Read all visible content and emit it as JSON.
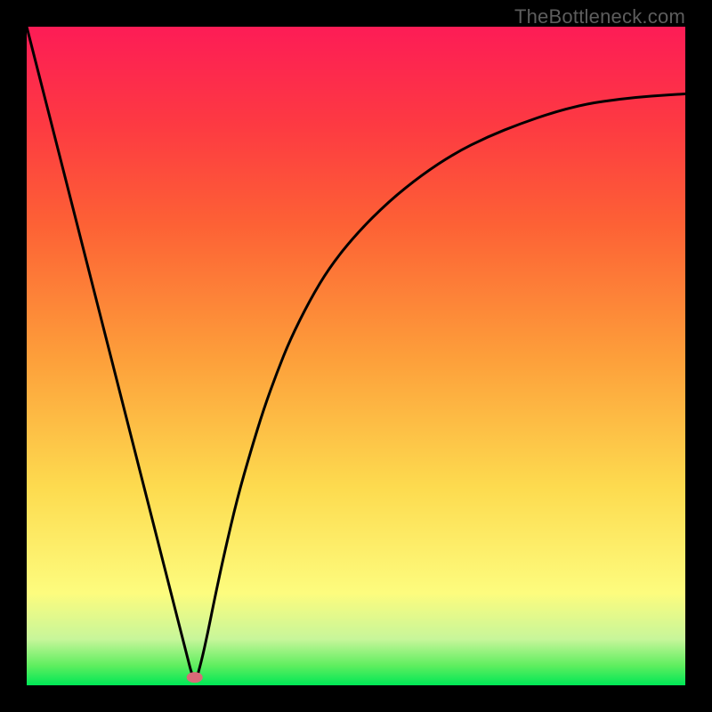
{
  "attribution": "TheBottleneck.com",
  "chart_data": {
    "type": "line",
    "title": "",
    "xlabel": "",
    "ylabel": "",
    "xlim": [
      0,
      1
    ],
    "ylim": [
      0,
      1
    ],
    "background_gradient": {
      "stops": [
        {
          "pos": 0.0,
          "color": "#00e756"
        },
        {
          "pos": 0.03,
          "color": "#5fee5f"
        },
        {
          "pos": 0.07,
          "color": "#c7f69a"
        },
        {
          "pos": 0.14,
          "color": "#fdfc7e"
        },
        {
          "pos": 0.3,
          "color": "#fddb4f"
        },
        {
          "pos": 0.5,
          "color": "#fd9e3a"
        },
        {
          "pos": 0.7,
          "color": "#fd6135"
        },
        {
          "pos": 0.85,
          "color": "#fd3a42"
        },
        {
          "pos": 1.0,
          "color": "#fd1c56"
        }
      ]
    },
    "marker": {
      "x": 0.255,
      "y": 0.012,
      "color": "#d96a78"
    },
    "x": [
      0.0,
      0.02,
      0.04,
      0.06,
      0.08,
      0.1,
      0.12,
      0.14,
      0.16,
      0.18,
      0.2,
      0.22,
      0.24,
      0.255,
      0.265,
      0.275,
      0.285,
      0.3,
      0.32,
      0.34,
      0.36,
      0.38,
      0.4,
      0.43,
      0.46,
      0.5,
      0.55,
      0.6,
      0.65,
      0.7,
      0.75,
      0.8,
      0.85,
      0.9,
      0.95,
      1.0
    ],
    "values": [
      1.0,
      0.922,
      0.843,
      0.765,
      0.686,
      0.608,
      0.529,
      0.451,
      0.372,
      0.294,
      0.215,
      0.137,
      0.058,
      0.0,
      0.035,
      0.08,
      0.13,
      0.2,
      0.285,
      0.355,
      0.42,
      0.475,
      0.525,
      0.585,
      0.635,
      0.685,
      0.735,
      0.775,
      0.808,
      0.833,
      0.853,
      0.87,
      0.883,
      0.89,
      0.895,
      0.898
    ]
  }
}
